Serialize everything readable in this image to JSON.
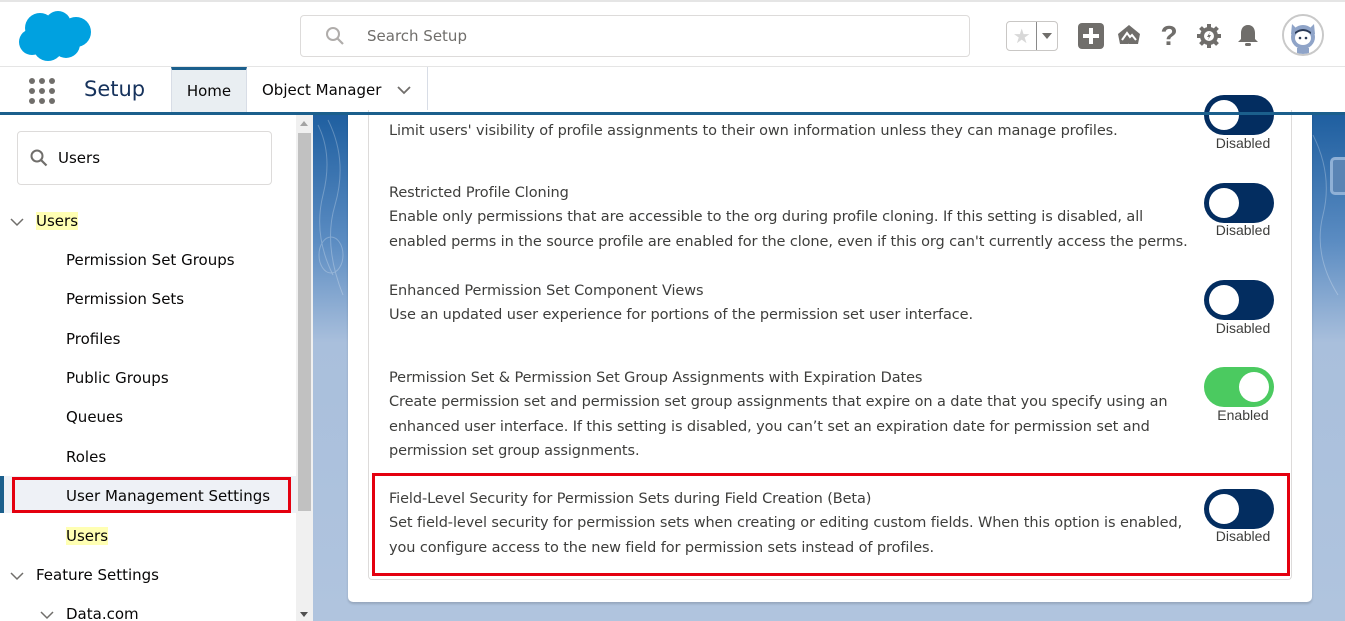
{
  "header": {
    "logo_icon": "salesforce-cloud-logo",
    "search_placeholder": "Search Setup",
    "icons": [
      "favorites-star-icon",
      "favorites-dropdown-icon",
      "global-actions-plus-icon",
      "trailhead-icon",
      "help-icon",
      "setup-gear-icon",
      "notifications-bell-icon",
      "user-avatar"
    ]
  },
  "nav": {
    "app_launcher_icon": "app-launcher-grid",
    "app_title": "Setup",
    "tabs": [
      {
        "label": "Home",
        "active": true
      },
      {
        "label": "Object Manager",
        "active": false,
        "has_dropdown": true
      }
    ]
  },
  "sidebar": {
    "quick_find_value": "Users",
    "tree": [
      {
        "label": "Users",
        "level": 0,
        "expanded": true,
        "highlighted": true
      },
      {
        "label": "Permission Set Groups",
        "level": 1
      },
      {
        "label": "Permission Sets",
        "level": 1
      },
      {
        "label": "Profiles",
        "level": 1
      },
      {
        "label": "Public Groups",
        "level": 1
      },
      {
        "label": "Queues",
        "level": 1
      },
      {
        "label": "Roles",
        "level": 1
      },
      {
        "label": "User Management Settings",
        "level": 1,
        "selected": true
      },
      {
        "label": "Users",
        "level": 1,
        "highlighted": true
      },
      {
        "label": "Feature Settings",
        "level": 0,
        "expanded": true
      },
      {
        "label": "Data.com",
        "level": 1,
        "expanded": true
      }
    ]
  },
  "settings": [
    {
      "title": "",
      "description": "Limit users' visibility of profile assignments to their own information unless they can manage profiles.",
      "enabled": false,
      "status": "Disabled"
    },
    {
      "title": "Restricted Profile Cloning",
      "description": "Enable only permissions that are accessible to the org during profile cloning. If this setting is disabled, all enabled perms in the source profile are enabled for the clone, even if this org can't currently access the perms.",
      "enabled": false,
      "status": "Disabled"
    },
    {
      "title": "Enhanced Permission Set Component Views",
      "description": "Use an updated user experience for portions of the permission set user interface.",
      "enabled": false,
      "status": "Disabled"
    },
    {
      "title": "Permission Set & Permission Set Group Assignments with Expiration Dates",
      "description": "Create permission set and permission set group assignments that expire on a date that you specify using an enhanced user interface. If this setting is disabled, you can’t set an expiration date for permission set and permission set group assignments.",
      "enabled": true,
      "status": "Enabled"
    },
    {
      "title": "Field-Level Security for Permission Sets during Field Creation (Beta)",
      "description": "Set field-level security for permission sets when creating or editing custom fields. When this option is enabled, you configure access to the new field for permission sets instead of profiles.",
      "enabled": false,
      "status": "Disabled"
    }
  ],
  "colors": {
    "brand_blue": "#00a1e0",
    "nav_accent": "#1b5f8c",
    "toggle_off": "#032d60",
    "toggle_on": "#4bca60",
    "highlight_box": "#e4000f",
    "search_highlight": "#ffffb3"
  }
}
